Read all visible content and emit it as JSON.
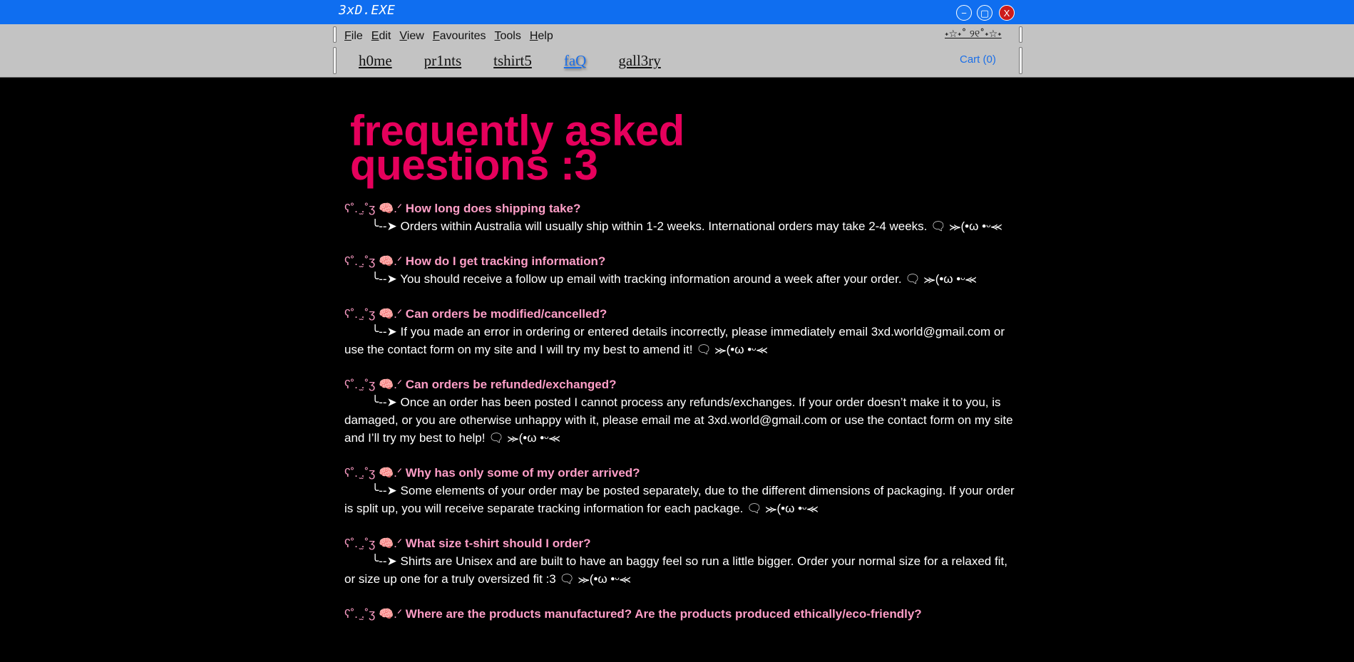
{
  "window": {
    "title": "3xD.EXE",
    "controls": {
      "minimize": "−",
      "maximize": "▢",
      "close": "X"
    }
  },
  "menubar": {
    "items": [
      {
        "label": "File",
        "underline": "F",
        "rest": "ile"
      },
      {
        "label": "Edit",
        "underline": "E",
        "rest": "dit"
      },
      {
        "label": "View",
        "underline": "V",
        "rest": "iew"
      },
      {
        "label": "Favourites",
        "underline": "F",
        "rest": "avourites"
      },
      {
        "label": "Tools",
        "underline": "T",
        "rest": "ools"
      },
      {
        "label": "Help",
        "underline": "H",
        "rest": "elp"
      }
    ],
    "decoration": "˖☆˖˚ ୨୧˚˖☆˖"
  },
  "nav": {
    "links": [
      {
        "label": "h0me",
        "active": false
      },
      {
        "label": "pr1nts",
        "active": false
      },
      {
        "label": "tshirt5",
        "active": false
      },
      {
        "label": "faQ",
        "active": true
      },
      {
        "label": "gall3ry",
        "active": false
      }
    ],
    "cart": "Cart (0)"
  },
  "page": {
    "title": "frequently asked questions :3",
    "question_prefix": "ʕ˚. ̫.˚ʒ 🧠.ᐟ ",
    "answer_prefix": "╰--➤ "
  },
  "faq": [
    {
      "q": "How long does shipping take?",
      "a": "Orders within Australia will usually ship within 1-2 weeks. International orders may take 2-4 weeks. 🗨 ⪼(•ω •ᵕ⪻"
    },
    {
      "q": "How do I get tracking information?",
      "a": "You should receive a follow up email with tracking information around a week after your order. 🗨 ⪼(•ω •ᵕ⪻"
    },
    {
      "q": "Can orders be modified/cancelled?",
      "a": "If you made an error in ordering or entered details incorrectly, please immediately email 3xd.world@gmail.com or use the contact form on my site and I will try my best to amend it! 🗨 ⪼(•ω •ᵕ⪻"
    },
    {
      "q": "Can orders be refunded/exchanged?",
      "a": "Once an order has been posted I cannot process any refunds/exchanges. If your order doesn’t make it to you, is damaged, or you are otherwise unhappy with it, please email me at 3xd.world@gmail.com or use the contact form on my site and I’ll try my best to help! 🗨 ⪼(•ω •ᵕ⪻"
    },
    {
      "q": "Why has only some of my order arrived?",
      "a": "Some elements of your order may be posted separately, due to the different dimensions of packaging. If your order is split up, you will receive separate tracking information for each package. 🗨 ⪼(•ω •ᵕ⪻"
    },
    {
      "q": "What size t-shirt should I order?",
      "a": "Shirts are Unisex and are built to have an baggy feel so run a little bigger. Order your normal size for a relaxed fit, or size up one for a truly oversized fit :3 🗨 ⪼(•ω •ᵕ⪻"
    },
    {
      "q": "Where are the products manufactured? Are the products produced ethically/eco-friendly?",
      "a": ""
    }
  ],
  "colors": {
    "titlebar": "#0f6ef0",
    "chrome": "#c3c3c3",
    "background": "#000000",
    "heading": "#e6005c",
    "question": "#ff9ec7",
    "answer": "#ffffff",
    "link_active": "#1b6fe8"
  }
}
